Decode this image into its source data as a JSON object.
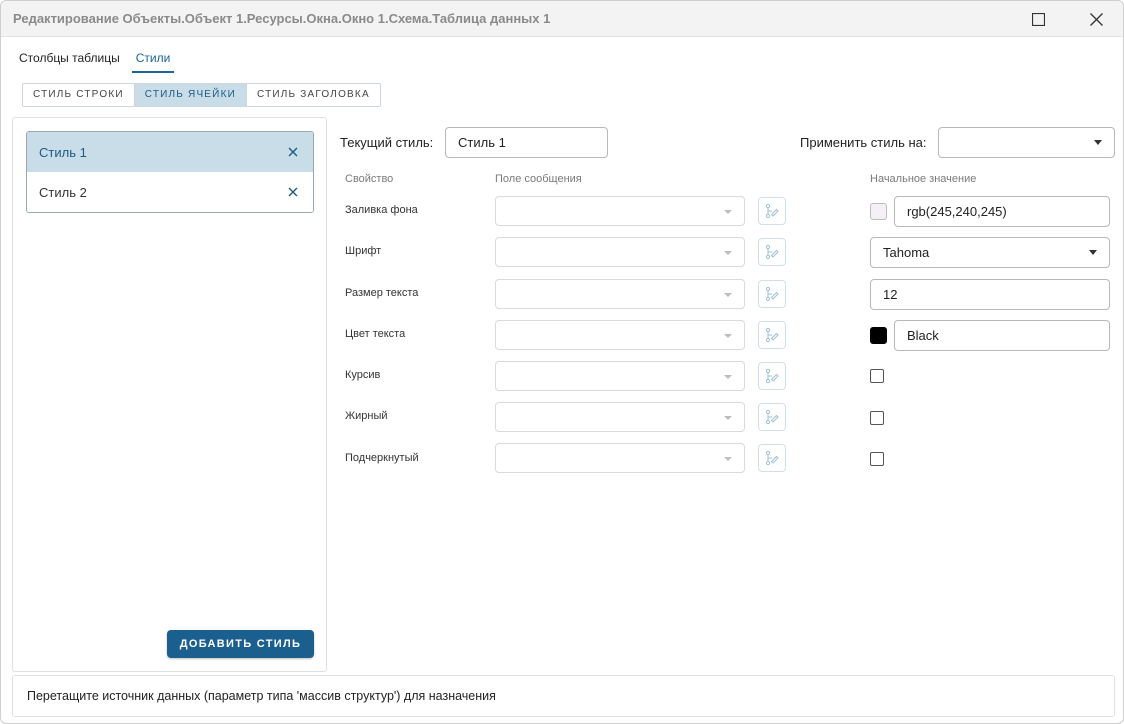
{
  "window": {
    "title": "Редактирование Объекты.Объект 1.Ресурсы.Окна.Окно 1.Схема.Таблица данных 1"
  },
  "top_tabs": [
    {
      "label": "Столбцы таблицы"
    },
    {
      "label": "Стили"
    }
  ],
  "segment_tabs": [
    {
      "label": "СТИЛЬ СТРОКИ"
    },
    {
      "label": "СТИЛЬ ЯЧЕЙКИ"
    },
    {
      "label": "СТИЛЬ ЗАГОЛОВКА"
    }
  ],
  "styles_list": [
    {
      "label": "Стиль 1"
    },
    {
      "label": "Стиль 2"
    }
  ],
  "add_style_label": "ДОБАВИТЬ СТИЛЬ",
  "current_style": {
    "label": "Текущий стиль:",
    "value": "Стиль 1"
  },
  "apply_to": {
    "label": "Применить стиль на:",
    "value": ""
  },
  "columns": {
    "property": "Свойство",
    "message_field": "Поле сообщения",
    "initial_value": "Начальное значение"
  },
  "properties": [
    {
      "label": "Заливка фона",
      "value": "rgb(245,240,245)",
      "swatch_color": "#f5f0f5"
    },
    {
      "label": "Шрифт",
      "value": "Tahoma"
    },
    {
      "label": "Размер текста",
      "value": "12"
    },
    {
      "label": "Цвет текста",
      "value": "Black",
      "swatch_color": "#000000"
    },
    {
      "label": "Курсив",
      "checked": false
    },
    {
      "label": "Жирный",
      "checked": false
    },
    {
      "label": "Подчеркнутый",
      "checked": false
    }
  ],
  "footer_hint": "Перетащите источник данных (параметр типа 'массив структур') для назначения",
  "colors": {
    "accent": "#1b5f8e",
    "selected_bg": "#c9dde9"
  }
}
